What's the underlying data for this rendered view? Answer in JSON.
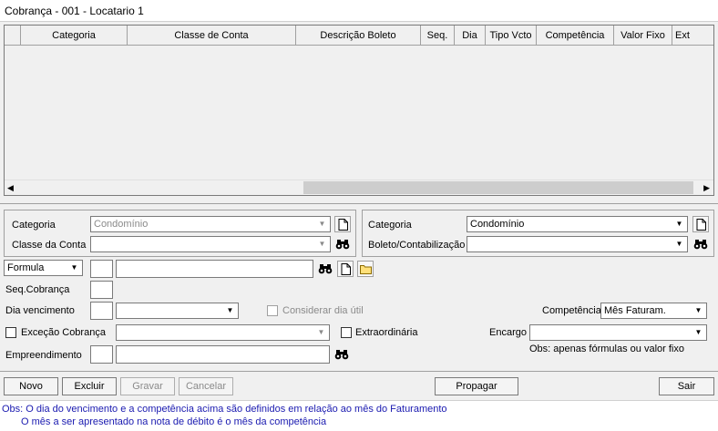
{
  "window": {
    "title": "Cobrança - 001 - Locatario 1"
  },
  "grid": {
    "columns": [
      "Categoria",
      "Classe de Conta",
      "Descrição Boleto",
      "Seq.",
      "Dia",
      "Tipo Vcto",
      "Competência",
      "Valor Fixo",
      "Ext"
    ],
    "scroll_left": "◀",
    "scroll_right": "▶"
  },
  "left_panel": {
    "categoria_label": "Categoria",
    "categoria_value": "Condomínio",
    "classe_label": "Classe da Conta",
    "classe_value": ""
  },
  "right_panel": {
    "categoria_label": "Categoria",
    "categoria_value": "Condomínio",
    "boleto_label": "Boleto/Contabilização",
    "boleto_value": ""
  },
  "form": {
    "formula_select": "Formula",
    "formula_code": "",
    "formula_desc": "",
    "seq_label": "Seq.Cobrança",
    "seq_value": "",
    "dia_label": "Dia vencimento",
    "dia_value": "",
    "dia_combo": "",
    "considerar_label": "Considerar dia útil",
    "competencia_label": "Competência",
    "competencia_value": "Mês Faturam.",
    "excecao_label": "Exceção Cobrança",
    "excecao_value": "",
    "extraordinaria_label": "Extraordinária",
    "encargo_label": "Encargo",
    "encargo_value": "",
    "encargo_obs": "Obs: apenas fórmulas ou valor fixo",
    "empreendimento_label": "Empreendimento",
    "empreendimento_code": "",
    "empreendimento_desc": ""
  },
  "buttons": {
    "novo": "Novo",
    "excluir": "Excluir",
    "gravar": "Gravar",
    "cancelar": "Cancelar",
    "propagar": "Propagar",
    "sair": "Sair"
  },
  "footer": {
    "line1": "Obs: O dia do vencimento e a competência acima são definidos em relação ao mês do Faturamento",
    "line2": "O mês a ser apresentado na nota de débito é o mês da competência"
  },
  "colors": {
    "note": "#1a1ab0",
    "disabled": "#8a8a8a"
  }
}
